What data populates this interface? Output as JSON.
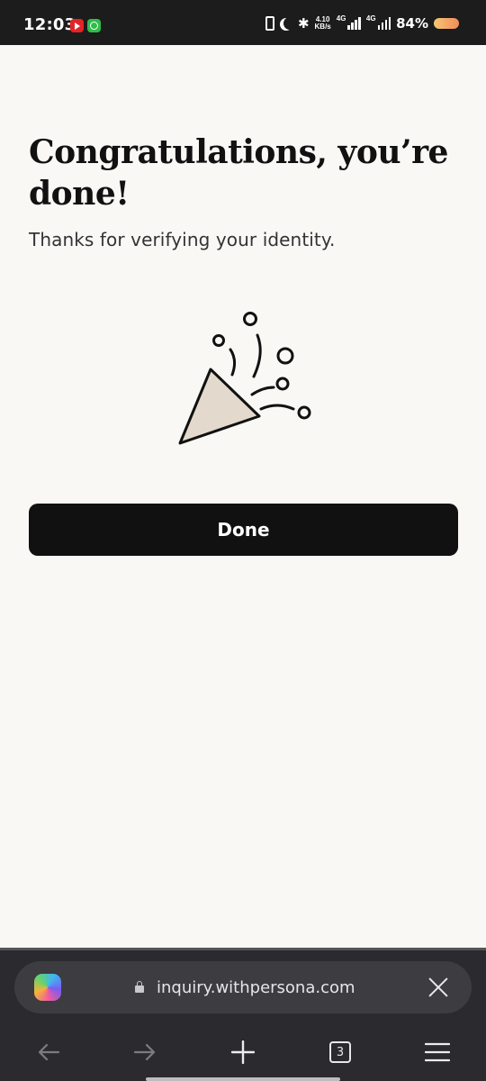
{
  "status_bar": {
    "time": "12:03",
    "net_speed_value": "4.10",
    "net_speed_unit": "KB/s",
    "sim1_type": "4G",
    "sim2_type": "4G",
    "battery": "84%",
    "battery_level": 0.84
  },
  "page": {
    "title": "Congratulations, you’re done!",
    "subtitle": "Thanks for verifying your identity.",
    "illustration": "party-popper",
    "done_label": "Done",
    "button_color": "#111111",
    "background_color": "#faf8f5"
  },
  "browser": {
    "url": "inquiry.withpersona.com",
    "tab_count": "3",
    "icons": [
      "copilot-icon",
      "lock-icon",
      "close-icon",
      "back-arrow-icon",
      "forward-arrow-icon",
      "plus-icon",
      "tabs-icon",
      "menu-icon"
    ]
  }
}
